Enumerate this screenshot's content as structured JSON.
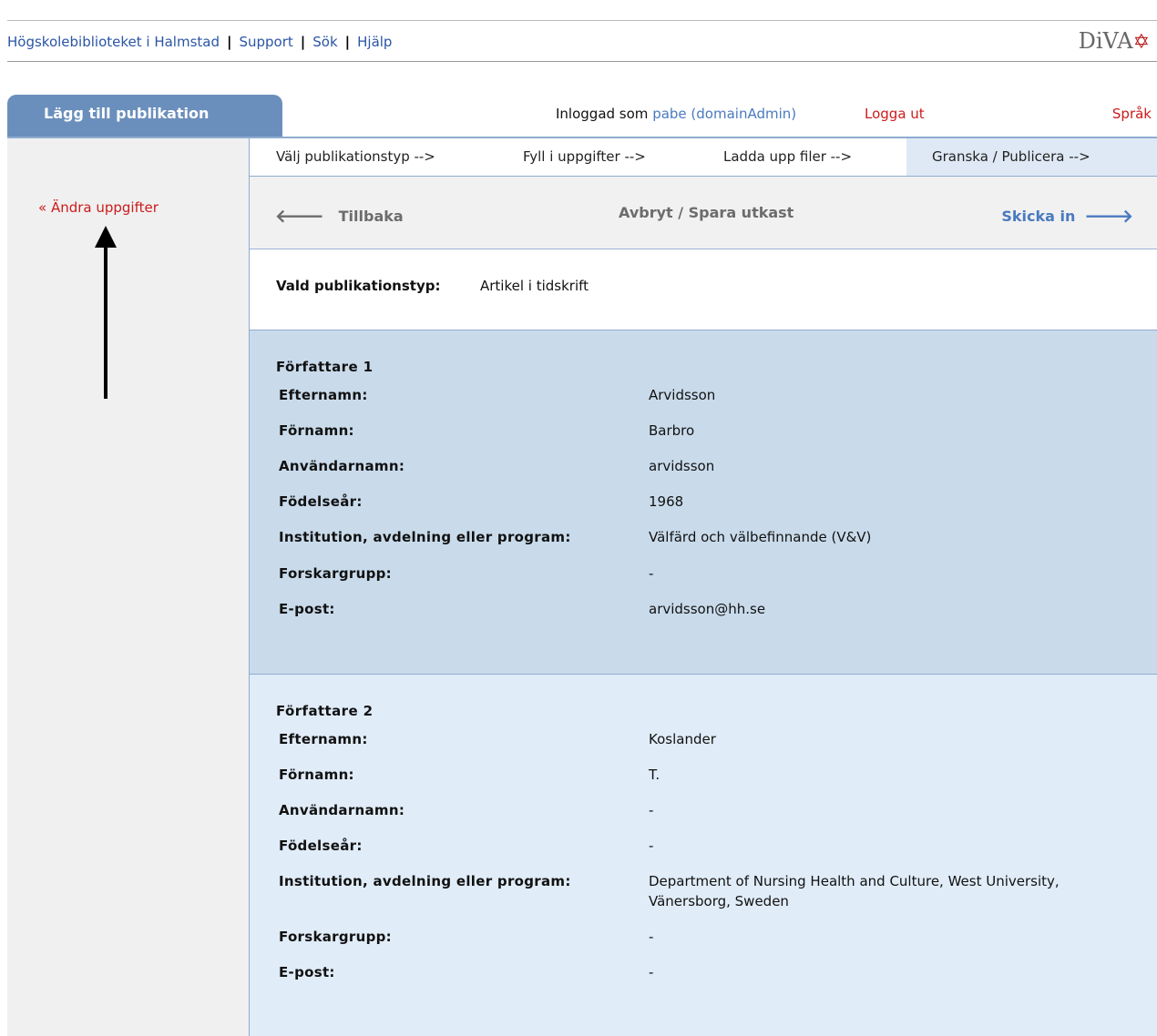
{
  "top_links": [
    "Högskolebiblioteket i Halmstad",
    "Support",
    "Sök",
    "Hjälp"
  ],
  "logo": {
    "text": "DiVA",
    "star": "✡"
  },
  "tab_label": "Lägg till publikation",
  "login": {
    "prefix": "Inloggad som",
    "user": "pabe (domainAdmin)",
    "logout": "Logga ut",
    "language": "Språk"
  },
  "sidebar": {
    "edit_link": "« Ändra uppgifter"
  },
  "steps": [
    "Välj publikationstyp -->",
    "Fyll i uppgifter -->",
    "Ladda upp filer -->",
    "Granska / Publicera -->"
  ],
  "active_step": 4,
  "actions": {
    "back": "Tillbaka",
    "cancel": "Avbryt / Spara utkast",
    "submit": "Skicka in"
  },
  "publication_type": {
    "label": "Vald publikationstyp:",
    "value": "Artikel i tidskrift"
  },
  "field_labels": {
    "lastname": "Efternamn:",
    "firstname": "Förnamn:",
    "username": "Användarnamn:",
    "birthyear": "Födelseår:",
    "institution": "Institution, avdelning eller program:",
    "researchgroup": "Forskargrupp:",
    "email": "E-post:"
  },
  "authors": [
    {
      "heading": "Författare 1",
      "lastname": "Arvidsson",
      "firstname": "Barbro",
      "username": "arvidsson",
      "birthyear": "1968",
      "institution": "Välfärd och välbefinnande (V&V)",
      "researchgroup": "-",
      "email": "arvidsson@hh.se"
    },
    {
      "heading": "Författare 2",
      "lastname": "Koslander",
      "firstname": "T.",
      "username": "-",
      "birthyear": "-",
      "institution": "Department of Nursing Health and Culture, West University, Vänersborg, Sweden",
      "researchgroup": "-",
      "email": "-"
    }
  ],
  "colors": {
    "link_blue": "#2a55a5",
    "tab_blue": "#6b8fbc",
    "alert_red": "#cc1b1b",
    "author1_bg": "#c9dbeb",
    "author2_bg": "#e0ecf8"
  }
}
